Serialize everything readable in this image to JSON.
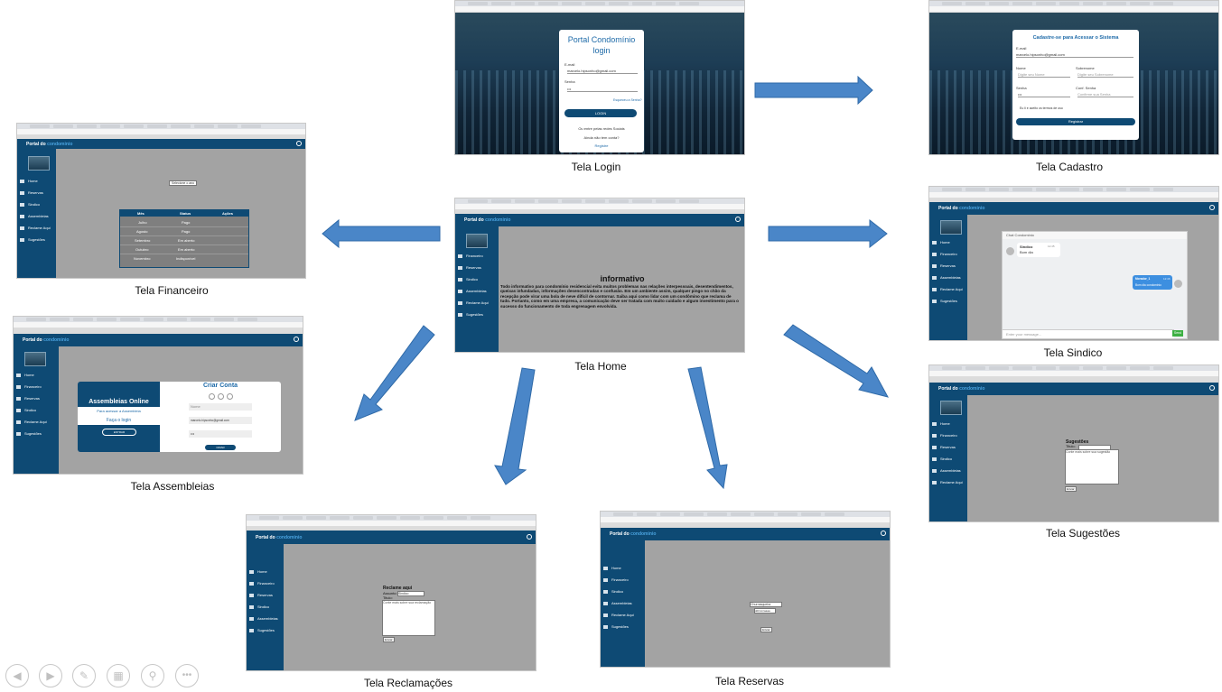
{
  "captions": {
    "login": "Tela Login",
    "cadastro": "Tela Cadastro",
    "financeiro": "Tela Financeiro",
    "home": "Tela Home",
    "sindico": "Tela Sindico",
    "assembleias": "Tela Assembleias",
    "sugestoes": "Tela Sugestões",
    "reclamacoes": "Tela Reclamações",
    "reservas": "Tela Reservas"
  },
  "brand": {
    "prefix": "Portal do",
    "suffix": "condominio"
  },
  "menu": {
    "home": "Home",
    "financeiro": "Financeiro",
    "reservas": "Reservas",
    "sindico": "Sindico",
    "assembleias": "Assembleias",
    "reclame": "Reclame Aqui",
    "sugestoes": "Sugestões"
  },
  "login": {
    "title_line1": "Portal Condomínio",
    "title_line2": "login",
    "email_label": "E-mail",
    "email_value": "marcelo.hipsonho@gmail.com",
    "senha_label": "Senha",
    "senha_value": "•••",
    "forgot": "Esqueceu a Senha?",
    "button": "LOGIN",
    "social": "Ou entre pelas redes Sociais",
    "no_account": "Ainda não tem conta?",
    "register": "Registre"
  },
  "cadastro": {
    "title": "Cadastre-se para Acessar o Sistema",
    "email_label": "E-mail",
    "email_value": "marcelo.hipsonho@gmail.com",
    "nome_label": "Nome",
    "nome_ph": "Digite seu Nome",
    "sobrenome_label": "Sobrenome",
    "sobrenome_ph": "Digite seu Sobrenome",
    "senha_label": "Senha",
    "senha_value": "•••",
    "conf_label": "Conf. Senha",
    "conf_ph": "Confirme sua Senha",
    "terms": "Eu li e aceito os termos de uso",
    "button": "Registrar"
  },
  "financeiro": {
    "select": "Selecione o ano",
    "headers": [
      "Mês",
      "Status",
      "Ações"
    ],
    "rows": [
      [
        "Julho",
        "Pago"
      ],
      [
        "Agosto",
        "Pago"
      ],
      [
        "Setembro",
        "Em aberto"
      ],
      [
        "Outubro",
        "Em aberto"
      ],
      [
        "Novembro",
        "Indisponível"
      ]
    ]
  },
  "home": {
    "heading": "informativo",
    "text": "Todo informativo para condomínio residencial evita muitos problemas nas relações interpessoais, desentendimentos, queixas infundadas, informações desencontradas e confusão. Em um ambiente assim, qualquer pingo no chão da recepção pode virar uma bola de neve difícil de contornar. Saiba aqui como lidar com um condômino que reclama de tudo. Portanto, como em uma empresa, a comunicação deve ser tratada com muito cuidado e algum investimento para o sucesso do funcionamento de toda engrenagem envolvida."
  },
  "sindico": {
    "header": "Chat Condominio",
    "msg1_name": "Sindico",
    "msg1_time": "12:45",
    "msg1_text": "Bom dia",
    "msg2_name": "Morador_1",
    "msg2_time": "12:46",
    "msg2_text": "Bom dia condominio",
    "input_ph": "Enter your message...",
    "send": "Send"
  },
  "assembleias": {
    "left_title": "Assembleias Online",
    "left_sub": "Para acessar a Assembleia",
    "left_sub2": "Faça o login",
    "left_btn": "ENTRAR",
    "right_title": "Criar Conta",
    "nome_ph": "Nome",
    "email_value": "marcelo.hipsonho@gmail.com",
    "senha_value": "•••",
    "right_btn": "CRIAR"
  },
  "sugestoes": {
    "title": "Sugestões",
    "titulo_label": "Titulo:",
    "textarea_ph": "Conte mais sobre sua sugestão",
    "button": "Enviar"
  },
  "reclamacoes": {
    "title": "Reclame aqui",
    "assunto_label": "Assunto:",
    "assunto_value": "Sindico",
    "titulo_label": "Titulo:",
    "textarea_ph": "Conte mais sobre sua reclamação",
    "button": "Enviar"
  },
  "reservas": {
    "select": "Churrasqueira",
    "date": "dd/mm/aaaa",
    "button": "Enviar"
  },
  "colors": {
    "navy": "#0e4a74",
    "content_gray": "#a3a3a3",
    "arrow": "#4a86c8"
  }
}
